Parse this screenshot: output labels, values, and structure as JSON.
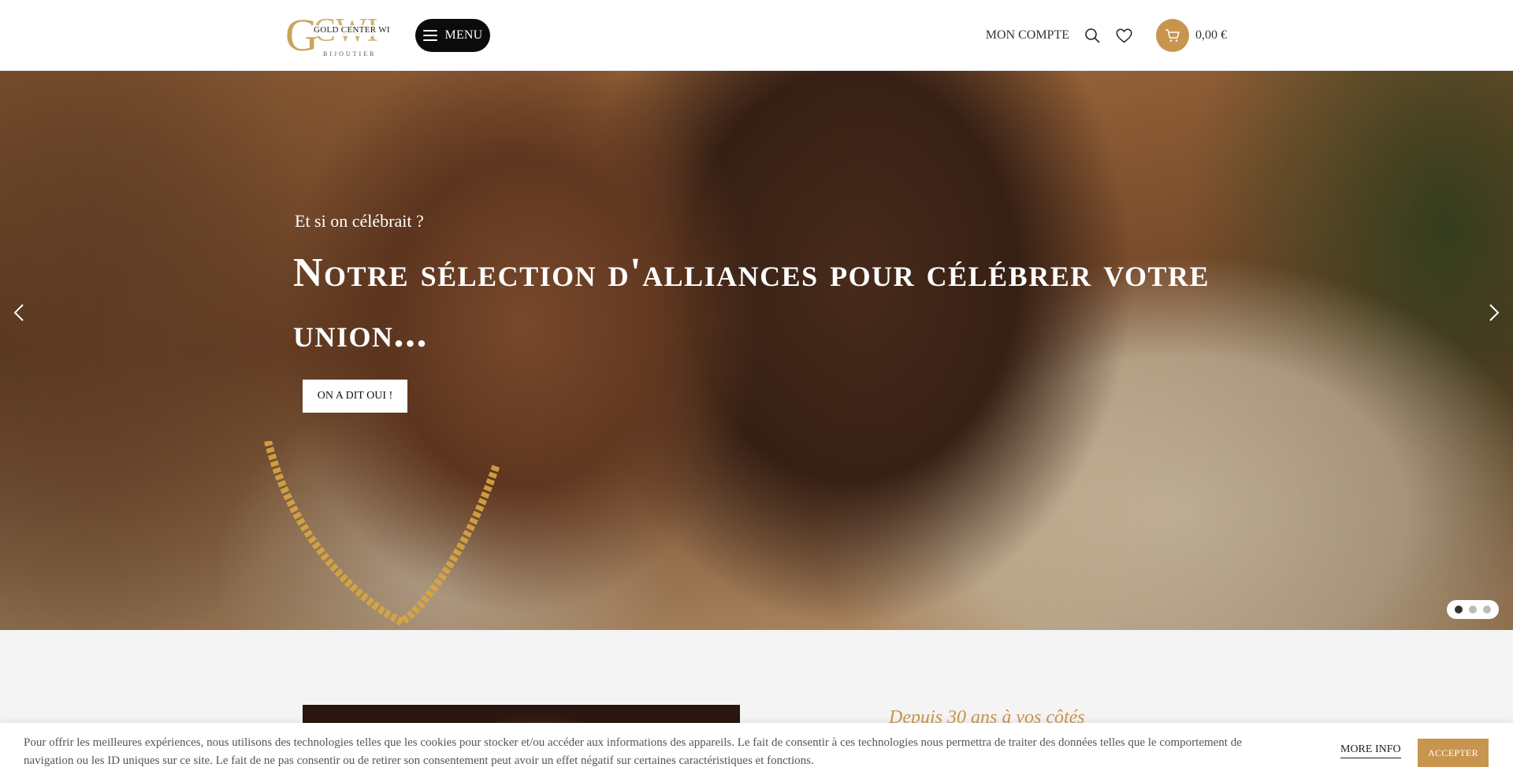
{
  "header": {
    "logo": {
      "letters": "GCWI",
      "name": "GOLD CENTER WI",
      "tagline": "BIJOUTIER"
    },
    "menu_label": "MENU",
    "account_label": "MON COMPTE",
    "cart": {
      "count": "0",
      "total": "0,00 €"
    }
  },
  "hero": {
    "subtitle": "Et si on célébrait ?",
    "title": "Notre sélection d'alliances pour célébrer votre union...",
    "cta_label": "ON A DIT OUI !",
    "slides": 3,
    "active_slide": 1
  },
  "section": {
    "tagline": "Depuis 30 ans à vos côtés"
  },
  "cookie": {
    "text": "Pour offrir les meilleures expériences, nous utilisons des technologies telles que les cookies pour stocker et/ou accéder aux informations des appareils. Le fait de consentir à ces technologies nous permettra de traiter des données telles que le comportement de navigation ou les ID uniques sur ce site. Le fait de ne pas consentir ou de retirer son consentement peut avoir un effet négatif sur certaines caractéristiques et fonctions.",
    "more_info_label": "MORE INFO",
    "accept_label": "ACCEPTER"
  },
  "colors": {
    "accent": "#c8954f",
    "menu_bg": "#0b0b0b"
  },
  "icons": [
    "hamburger-icon",
    "search-icon",
    "heart-icon",
    "cart-icon",
    "chevron-left-icon",
    "chevron-right-icon"
  ]
}
